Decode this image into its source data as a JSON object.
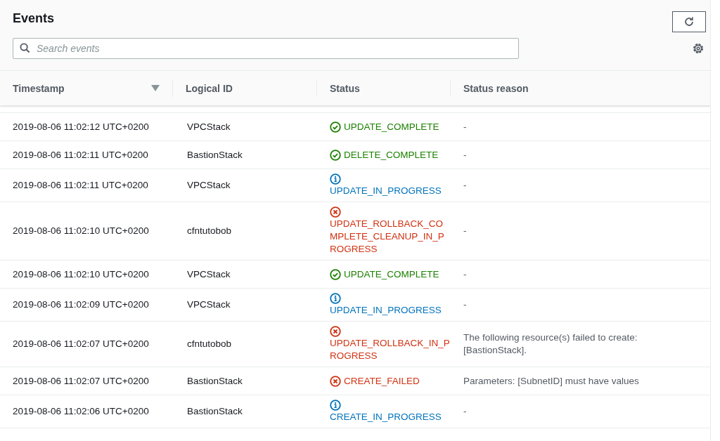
{
  "title": "Events",
  "search": {
    "placeholder": "Search events"
  },
  "table": {
    "columns": [
      {
        "label": "Timestamp",
        "sorted": true
      },
      {
        "label": "Logical ID",
        "sorted": false
      },
      {
        "label": "Status",
        "sorted": false
      },
      {
        "label": "Status reason",
        "sorted": false
      }
    ],
    "rows": [
      {
        "timestamp": "2019-08-06 11:02:12 UTC+0200",
        "logical_id": "VPCStack",
        "status": "UPDATE_COMPLETE",
        "kind": "success",
        "reason": "-"
      },
      {
        "timestamp": "2019-08-06 11:02:11 UTC+0200",
        "logical_id": "BastionStack",
        "status": "DELETE_COMPLETE",
        "kind": "success",
        "reason": "-"
      },
      {
        "timestamp": "2019-08-06 11:02:11 UTC+0200",
        "logical_id": "VPCStack",
        "status": "UPDATE_IN_PROGRESS",
        "kind": "info",
        "reason": "-"
      },
      {
        "timestamp": "2019-08-06 11:02:10 UTC+0200",
        "logical_id": "cfntutobob",
        "status": "UPDATE_ROLLBACK_COMPLETE_CLEANUP_IN_PROGRESS",
        "kind": "error",
        "reason": "-"
      },
      {
        "timestamp": "2019-08-06 11:02:10 UTC+0200",
        "logical_id": "VPCStack",
        "status": "UPDATE_COMPLETE",
        "kind": "success",
        "reason": "-"
      },
      {
        "timestamp": "2019-08-06 11:02:09 UTC+0200",
        "logical_id": "VPCStack",
        "status": "UPDATE_IN_PROGRESS",
        "kind": "info",
        "reason": "-"
      },
      {
        "timestamp": "2019-08-06 11:02:07 UTC+0200",
        "logical_id": "cfntutobob",
        "status": "UPDATE_ROLLBACK_IN_PROGRESS",
        "kind": "error",
        "reason": "The following resource(s) failed to create: [BastionStack]."
      },
      {
        "timestamp": "2019-08-06 11:02:07 UTC+0200",
        "logical_id": "BastionStack",
        "status": "CREATE_FAILED",
        "kind": "error",
        "reason": "Parameters: [SubnetID] must have values"
      },
      {
        "timestamp": "2019-08-06 11:02:06 UTC+0200",
        "logical_id": "BastionStack",
        "status": "CREATE_IN_PROGRESS",
        "kind": "info",
        "reason": "-"
      }
    ]
  }
}
